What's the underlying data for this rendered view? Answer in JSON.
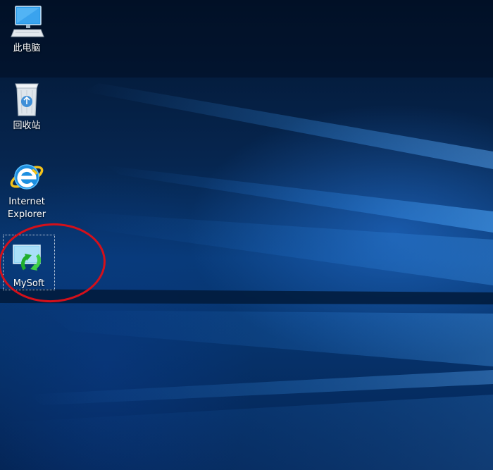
{
  "desktop": {
    "icons": [
      {
        "id": "this-pc",
        "label": "此电脑"
      },
      {
        "id": "recycle-bin",
        "label": "回收站"
      },
      {
        "id": "internet-explorer",
        "label": "Internet\nExplorer"
      },
      {
        "id": "mysoft",
        "label": "MySoft"
      }
    ]
  },
  "colors": {
    "highlight_ring": "#d4101a",
    "wallpaper_blue": "#0b4a9a"
  }
}
